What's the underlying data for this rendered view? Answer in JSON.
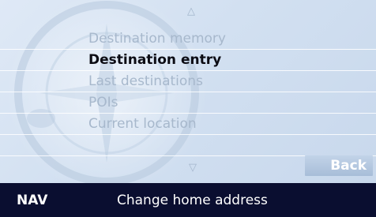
{
  "menu": {
    "up_arrow": "△",
    "down_arrow": "▽",
    "items": [
      {
        "label": "Destination memory",
        "selected": false
      },
      {
        "label": "Destination entry",
        "selected": true
      },
      {
        "label": "Last destinations",
        "selected": false
      },
      {
        "label": "POIs",
        "selected": false
      },
      {
        "label": "Current location",
        "selected": false
      },
      {
        "label": "",
        "selected": false
      }
    ],
    "back_label": "Back"
  },
  "status_bar": {
    "mode": "NAV",
    "message": "Change home address"
  },
  "icons": {
    "background": "compass-icon",
    "scroll_up": "triangle-up-icon",
    "scroll_down": "triangle-down-icon"
  },
  "colors": {
    "background": "#d2e0f1",
    "status_bar": "#0a0e30",
    "selected_text": "#0c0c14",
    "unselected_text": "#a7b8cc",
    "back_button": "#b4c7df"
  }
}
